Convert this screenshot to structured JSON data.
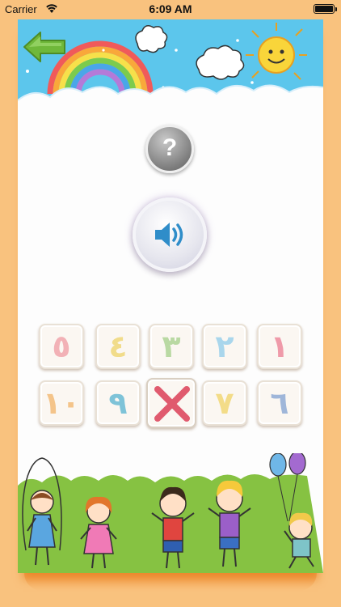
{
  "status_bar": {
    "carrier": "Carrier",
    "time": "6:09 AM"
  },
  "colors": {
    "page_bg": "#f9c27e",
    "sky": "#5cc6ec",
    "grass": "#86c242",
    "back_arrow": "#6fb83a"
  },
  "icons": {
    "back": "arrow-left-icon",
    "help": "question-mark-icon",
    "sound": "speaker-icon",
    "wrong": "red-x-mark-icon"
  },
  "help_button": {
    "label": "?"
  },
  "number_tiles": [
    {
      "row": 1,
      "digit": "٥",
      "color": "#f2b1b6",
      "state": "normal"
    },
    {
      "row": 1,
      "digit": "٤",
      "color": "#f1dc8a",
      "state": "normal"
    },
    {
      "row": 1,
      "digit": "٣",
      "color": "#b9d9a3",
      "state": "normal"
    },
    {
      "row": 1,
      "digit": "٢",
      "color": "#a9d6ec",
      "state": "normal"
    },
    {
      "row": 1,
      "digit": "١",
      "color": "#ef9aa9",
      "state": "normal"
    },
    {
      "row": 2,
      "digit": "١٠",
      "color": "#f4c48a",
      "state": "normal"
    },
    {
      "row": 2,
      "digit": "٩",
      "color": "#7ec3d8",
      "state": "normal"
    },
    {
      "row": 2,
      "digit": "",
      "color": "#e05a6e",
      "state": "wrong"
    },
    {
      "row": 2,
      "digit": "٧",
      "color": "#f3dc88",
      "state": "normal"
    },
    {
      "row": 2,
      "digit": "٦",
      "color": "#9fb6d9",
      "state": "normal"
    }
  ]
}
